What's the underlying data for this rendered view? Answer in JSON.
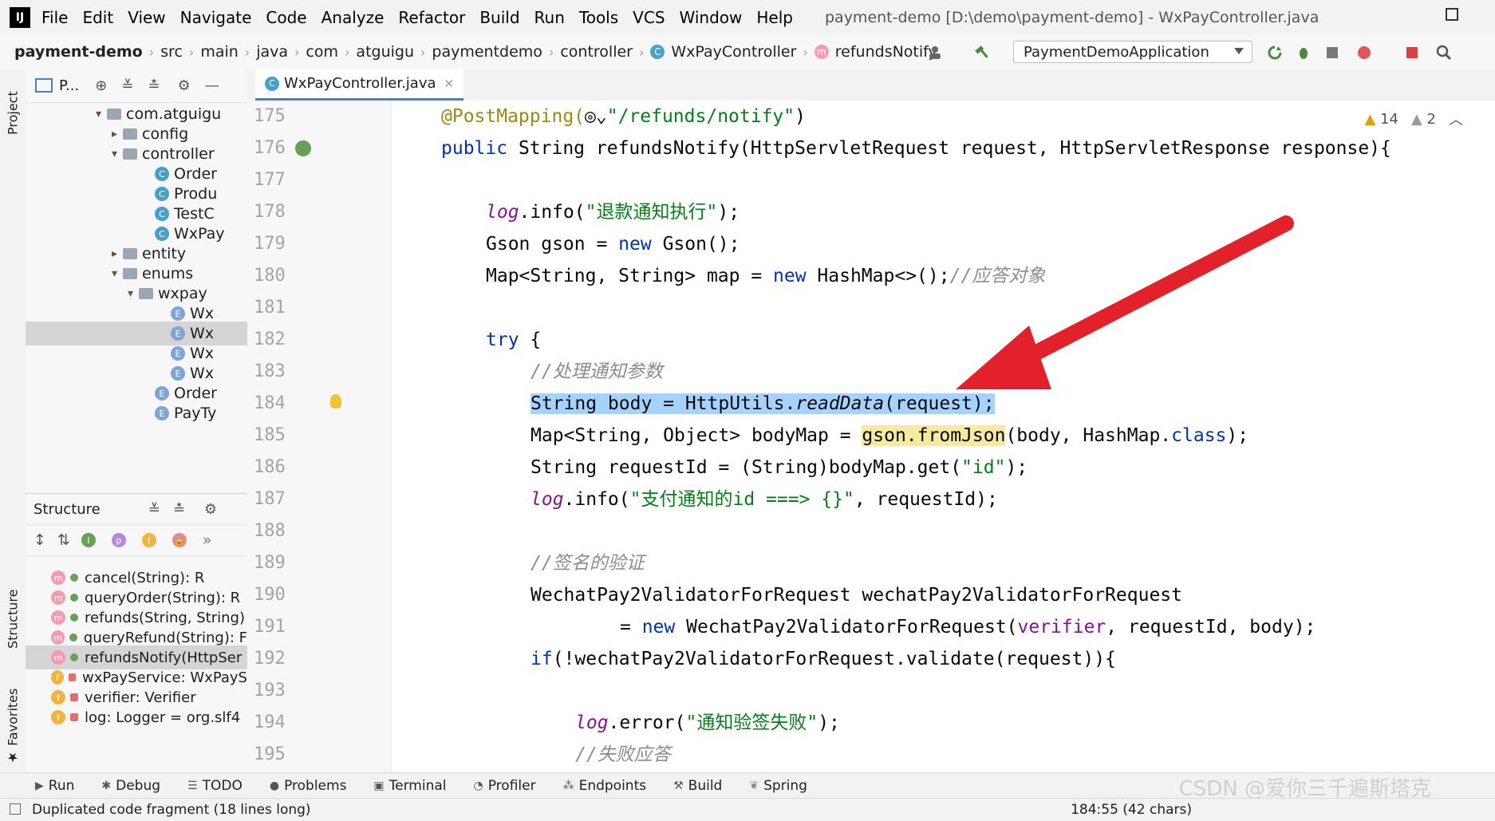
{
  "menubar": {
    "logo": "IJ",
    "items": [
      "File",
      "Edit",
      "View",
      "Navigate",
      "Code",
      "Analyze",
      "Refactor",
      "Build",
      "Run",
      "Tools",
      "VCS",
      "Window",
      "Help"
    ],
    "window_title": "payment-demo [D:\\demo\\payment-demo] - WxPayController.java"
  },
  "navbar": {
    "crumbs": [
      "payment-demo",
      "src",
      "main",
      "java",
      "com",
      "atguigu",
      "paymentdemo",
      "controller",
      "WxPayController",
      "refundsNotify"
    ],
    "run_config": "PaymentDemoApplication"
  },
  "project_panel": {
    "header": "P...",
    "tree": [
      {
        "label": "com.atguigu",
        "arrow": "▾",
        "kind": "folder",
        "indent": 120
      },
      {
        "label": "config",
        "arrow": "▸",
        "kind": "folder",
        "indent": 140
      },
      {
        "label": "controller",
        "arrow": "▾",
        "kind": "folder",
        "indent": 140
      },
      {
        "label": "Order",
        "arrow": "",
        "kind": "class",
        "indent": 180
      },
      {
        "label": "Produ",
        "arrow": "",
        "kind": "class",
        "indent": 180
      },
      {
        "label": "TestC",
        "arrow": "",
        "kind": "class",
        "indent": 180
      },
      {
        "label": "WxPay",
        "arrow": "",
        "kind": "class",
        "indent": 180
      },
      {
        "label": "entity",
        "arrow": "▸",
        "kind": "folder",
        "indent": 140
      },
      {
        "label": "enums",
        "arrow": "▾",
        "kind": "folder",
        "indent": 140
      },
      {
        "label": "wxpay",
        "arrow": "▾",
        "kind": "folder",
        "indent": 160
      },
      {
        "label": "Wx",
        "arrow": "",
        "kind": "enum",
        "indent": 200
      },
      {
        "label": "Wx",
        "arrow": "",
        "kind": "enum",
        "indent": 200,
        "selected": true
      },
      {
        "label": "Wx",
        "arrow": "",
        "kind": "enum",
        "indent": 200
      },
      {
        "label": "Wx",
        "arrow": "",
        "kind": "enum",
        "indent": 200
      },
      {
        "label": "Order",
        "arrow": "",
        "kind": "enum",
        "indent": 180
      },
      {
        "label": "PayTy",
        "arrow": "",
        "kind": "enum",
        "indent": 180
      }
    ]
  },
  "structure_panel": {
    "title": "Structure",
    "items": [
      {
        "icon": "m",
        "label": "cancel(String): R"
      },
      {
        "icon": "m",
        "label": "queryOrder(String): R"
      },
      {
        "icon": "m",
        "label": "refunds(String, String)"
      },
      {
        "icon": "m",
        "label": "queryRefund(String): F"
      },
      {
        "icon": "m",
        "label": "refundsNotify(HttpSer",
        "selected": true
      },
      {
        "icon": "f",
        "label": "wxPayService: WxPayS"
      },
      {
        "icon": "f",
        "label": "verifier: Verifier"
      },
      {
        "icon": "f",
        "label": "log: Logger = org.slf4"
      }
    ]
  },
  "editor": {
    "tab_label": "WxPayController.java",
    "inspections": {
      "warnings": "14",
      "weak_warnings": "2"
    },
    "line_numbers": [
      "175",
      "176",
      "177",
      "178",
      "179",
      "180",
      "181",
      "182",
      "183",
      "184",
      "185",
      "186",
      "187",
      "188",
      "189",
      "190",
      "191",
      "192",
      "193",
      "194",
      "195"
    ],
    "lines": [
      {
        "indent": 0,
        "segments": [
          {
            "t": "@PostMapping(",
            "c": "ann"
          },
          {
            "t": "◎⌄",
            "c": ""
          },
          {
            "t": "\"/refunds/notify\"",
            "c": "str"
          },
          {
            "t": ")",
            "c": ""
          }
        ]
      },
      {
        "indent": 0,
        "segments": [
          {
            "t": "public ",
            "c": "kw"
          },
          {
            "t": "String ",
            "c": ""
          },
          {
            "t": "refundsNotify",
            "c": ""
          },
          {
            "t": "(HttpServletRequest request, HttpServletResponse response){",
            "c": ""
          }
        ]
      },
      {
        "indent": 0,
        "segments": []
      },
      {
        "indent": 2,
        "segments": [
          {
            "t": "log",
            "c": "fld itl"
          },
          {
            "t": ".info(",
            "c": ""
          },
          {
            "t": "\"退款通知执行\"",
            "c": "str"
          },
          {
            "t": ");",
            "c": ""
          }
        ]
      },
      {
        "indent": 2,
        "segments": [
          {
            "t": "Gson gson = ",
            "c": ""
          },
          {
            "t": "new ",
            "c": "kw"
          },
          {
            "t": "Gson();",
            "c": ""
          }
        ]
      },
      {
        "indent": 2,
        "segments": [
          {
            "t": "Map<String, String> map = ",
            "c": ""
          },
          {
            "t": "new ",
            "c": "kw"
          },
          {
            "t": "HashMap<>();",
            "c": ""
          },
          {
            "t": "//应答对象",
            "c": "cmt"
          }
        ]
      },
      {
        "indent": 0,
        "segments": []
      },
      {
        "indent": 2,
        "segments": [
          {
            "t": "try ",
            "c": "kw"
          },
          {
            "t": "{",
            "c": ""
          }
        ]
      },
      {
        "indent": 4,
        "segments": [
          {
            "t": "//处理通知参数",
            "c": "cmt"
          }
        ]
      },
      {
        "indent": 4,
        "segments": [
          {
            "t": "String body = HttpUtils.",
            "c": "hl-sel"
          },
          {
            "t": "readData",
            "c": "hl-sel itl"
          },
          {
            "t": "(request);",
            "c": "hl-sel"
          }
        ]
      },
      {
        "indent": 4,
        "segments": [
          {
            "t": "Map<String, Object> bodyMap = ",
            "c": ""
          },
          {
            "t": "gson.fromJson",
            "c": "hl-warn"
          },
          {
            "t": "(body, HashMap.",
            "c": ""
          },
          {
            "t": "class",
            "c": "kw"
          },
          {
            "t": ");",
            "c": ""
          }
        ]
      },
      {
        "indent": 4,
        "segments": [
          {
            "t": "String requestId = (String)bodyMap.get(",
            "c": ""
          },
          {
            "t": "\"id\"",
            "c": "str"
          },
          {
            "t": ");",
            "c": ""
          }
        ]
      },
      {
        "indent": 4,
        "segments": [
          {
            "t": "log",
            "c": "fld itl"
          },
          {
            "t": ".info(",
            "c": ""
          },
          {
            "t": "\"支付通知的id ===> {}\"",
            "c": "str"
          },
          {
            "t": ", requestId);",
            "c": ""
          }
        ]
      },
      {
        "indent": 0,
        "segments": []
      },
      {
        "indent": 4,
        "segments": [
          {
            "t": "//签名的验证",
            "c": "cmt"
          }
        ]
      },
      {
        "indent": 4,
        "segments": [
          {
            "t": "WechatPay2ValidatorForRequest wechatPay2ValidatorForRequest",
            "c": ""
          }
        ]
      },
      {
        "indent": 8,
        "segments": [
          {
            "t": "= ",
            "c": ""
          },
          {
            "t": "new ",
            "c": "kw"
          },
          {
            "t": "WechatPay2ValidatorForRequest(",
            "c": ""
          },
          {
            "t": "verifier",
            "c": "fld"
          },
          {
            "t": ", requestId, body);",
            "c": ""
          }
        ]
      },
      {
        "indent": 4,
        "segments": [
          {
            "t": "if",
            "c": "kw"
          },
          {
            "t": "(!wechatPay2ValidatorForRequest.validate(request)){",
            "c": ""
          }
        ]
      },
      {
        "indent": 0,
        "segments": []
      },
      {
        "indent": 6,
        "segments": [
          {
            "t": "log",
            "c": "fld itl"
          },
          {
            "t": ".error(",
            "c": ""
          },
          {
            "t": "\"通知验签失败\"",
            "c": "str"
          },
          {
            "t": ");",
            "c": ""
          }
        ]
      },
      {
        "indent": 6,
        "segments": [
          {
            "t": "//失败应答",
            "c": "cmt"
          }
        ]
      }
    ]
  },
  "bottom_tools": [
    "Run",
    "Debug",
    "TODO",
    "Problems",
    "Terminal",
    "Profiler",
    "Endpoints",
    "Build",
    "Spring"
  ],
  "status": {
    "message": "Duplicated code fragment (18 lines long)",
    "position": "184:55 (42 chars)"
  },
  "watermark": "CSDN @爱你三千遍斯塔克"
}
